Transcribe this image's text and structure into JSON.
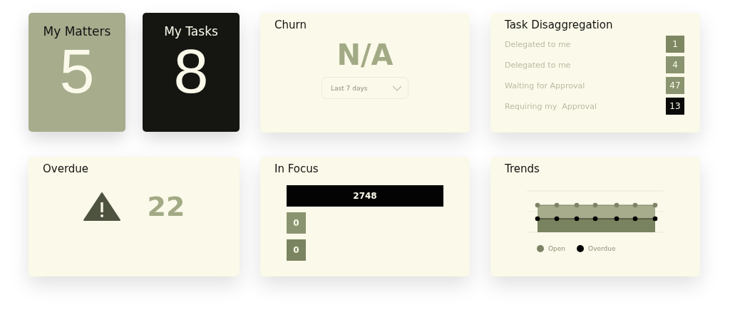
{
  "tiles": [
    {
      "title": "My Matters",
      "count": "5",
      "kind": "light"
    },
    {
      "title": "My Tasks",
      "count": "8",
      "kind": "dark"
    }
  ],
  "churn": {
    "title": "Churn",
    "value": "N/A",
    "period": "Last 7 days"
  },
  "task_disaggregation": {
    "title": "Task Disaggregation",
    "rows": [
      {
        "label": "Delegated to me",
        "count": "1",
        "color": "#7d8762"
      },
      {
        "label": "Delegated to me",
        "count": "4",
        "color": "#8a9470"
      },
      {
        "label": "Waiting for Approval",
        "count": "47",
        "color": "#8a9470"
      },
      {
        "label": "Requiring my  Approval",
        "count": "13",
        "color": "#0a0a08"
      }
    ]
  },
  "overdue": {
    "title": "Overdue",
    "count": "22"
  },
  "in_focus": {
    "title": "In Focus",
    "bars": [
      {
        "value": "2748",
        "color": "#030303"
      },
      {
        "value": "0",
        "color": "#8a9470"
      },
      {
        "value": "0",
        "color": "#7a8460"
      }
    ]
  },
  "trends": {
    "title": "Trends",
    "legend": [
      {
        "label": "Open",
        "color": "#7d8466"
      },
      {
        "label": "Overdue",
        "color": "#000000"
      }
    ]
  }
}
